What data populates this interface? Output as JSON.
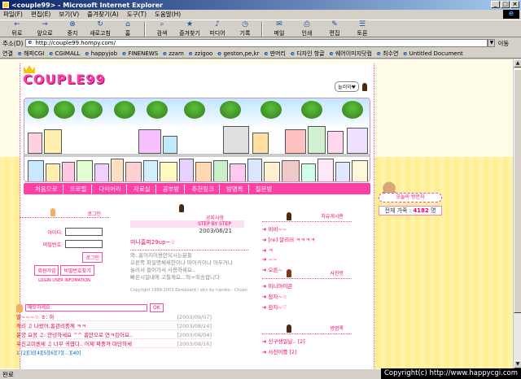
{
  "window": {
    "title": "<couple99> - Microsoft Internet Explorer",
    "btn_min": "_",
    "btn_max": "□",
    "btn_close": "×"
  },
  "menu": [
    "파일(F)",
    "편집(E)",
    "보기(V)",
    "즐겨찾기(A)",
    "도구(T)",
    "도움말(H)"
  ],
  "toolbar": [
    {
      "label": "뒤로",
      "icon": "back-arrow-icon",
      "glyph": "←"
    },
    {
      "label": "앞으로",
      "icon": "forward-arrow-icon",
      "glyph": "→"
    },
    {
      "label": "중지",
      "icon": "stop-icon",
      "glyph": "⊗"
    },
    {
      "label": "새로고침",
      "icon": "refresh-icon",
      "glyph": "↻"
    },
    {
      "label": "홈",
      "icon": "home-icon",
      "glyph": "⌂"
    },
    {
      "label": "검색",
      "icon": "search-icon",
      "glyph": "⌕"
    },
    {
      "label": "즐겨찾기",
      "icon": "favorites-icon",
      "glyph": "★"
    },
    {
      "label": "미디어",
      "icon": "media-icon",
      "glyph": "♪"
    },
    {
      "label": "기록",
      "icon": "history-icon",
      "glyph": "◷"
    },
    {
      "label": "메일",
      "icon": "mail-icon",
      "glyph": "✉"
    },
    {
      "label": "인쇄",
      "icon": "print-icon",
      "glyph": "⎙"
    },
    {
      "label": "편집",
      "icon": "edit-icon",
      "glyph": "✎"
    },
    {
      "label": "토론",
      "icon": "discuss-icon",
      "glyph": "☰"
    }
  ],
  "address": {
    "label": "주소(D)",
    "url": "http://couple99.hompy.com/",
    "go": "이동"
  },
  "links": {
    "label": "연결",
    "items": [
      "해피CGI",
      "CGIMALL",
      "happyjob",
      "FINENEWS",
      "zzam",
      "zzigoo",
      "geston,pe,kr",
      "딴머리",
      "디자인 항글",
      "쉐어이미지닷컴",
      "최수연",
      "Untitled Document"
    ]
  },
  "site": {
    "logo": "COUPLE99",
    "speech": "놀러와♥",
    "nav": [
      "처음으로",
      "프로필",
      "다이어리",
      "자료실",
      "공부방",
      "추천링크",
      "방명록",
      "질문방"
    ],
    "login": {
      "title": "로그인",
      "id_label": "아이디:",
      "pw_label": "비밀번호:",
      "login_btn": "로그인",
      "join_btn": "회원가입",
      "find_btn": "비밀번호찾기",
      "guide": "LOGIN USER INFOMATION"
    },
    "notice": {
      "header": "공지사항",
      "date_badge": "STEP BY STEP",
      "date": "2003/06/21",
      "title": "미니홈피29up~☆",
      "body": "와..홈이지이용안되시는분들\n오른쪽 파일명체세한이나 마이키이나 아두거나\n놀러서 들어가서 사용하세요..\n빠른시일내에 고칠께요...헉ㅜ죄송합니다.",
      "credit": "Copyright 1999-2003 Zeroboard / skin by hansko - Chuan"
    },
    "right_list_1": {
      "title": "자유게시판",
      "items": [
        "비비~~",
        "[re] 알리러 ㅋㅋㅋㅋ",
        "ㅋ",
        "~~",
        "오른~"
      ]
    },
    "right_list_2": {
      "title": "사진방",
      "items": [
        "미니아이콘",
        "잠자~☆",
        "잠자~♡"
      ]
    },
    "right_list_3": {
      "title": "방명록",
      "items": [
        "신구생일날.. [2]",
        "사진이를 [2]"
      ]
    },
    "guestbook": {
      "input_placeholder": "메모하세요",
      "ok": "OK",
      "rows": [
        {
          "text": "딸~~~☆ ㅎ: 하",
          "date": "[2003/09/07]"
        },
        {
          "text": "캐리 ♫ 나왔어,홈관리중께 ㅋㅋ",
          "date": "[2003/08/24]"
        },
        {
          "text": "윤양 요정 ♫: 안녕하세요 ^^ 홈만으로 연ㅋ린어요..",
          "date": "[2003/08/04]"
        },
        {
          "text": "우진고미센세 ♫ 너무 귀엽다.. 어제 짜중져 대단하세",
          "date": "[2003/08/16]"
        }
      ],
      "pager": "1 [2][3][4][5][6][7][...][40]"
    },
    "sidebar": {
      "today": "오늘의 방문자",
      "visitor_label": "전체 가족 :",
      "visitor_count": "4182",
      "visitor_suffix": "명"
    }
  },
  "status": {
    "text": "완료",
    "copyright": "Copyright(c) http://www.happycgi.com"
  },
  "colors": {
    "accent": "#ff3fa6",
    "stripe": "#fff3a8",
    "ie_title": "#0a246a"
  }
}
